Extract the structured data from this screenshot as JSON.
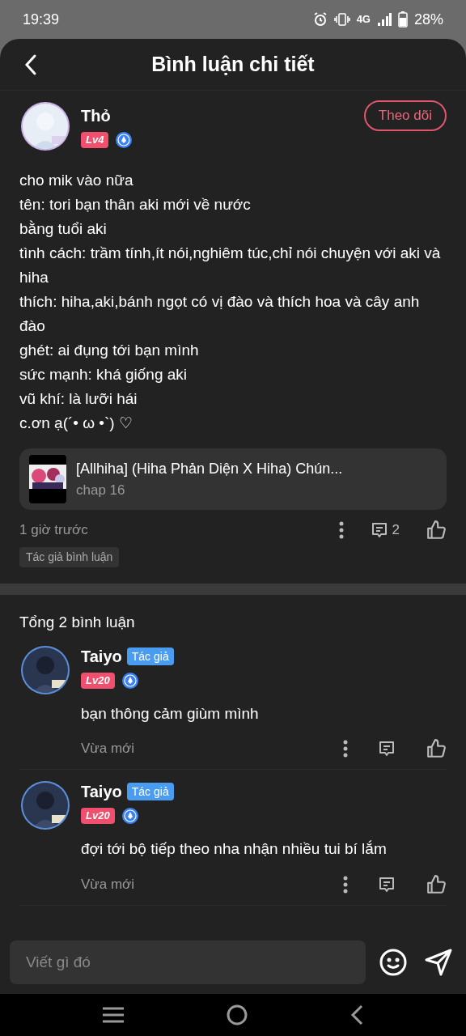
{
  "status_bar": {
    "time": "19:39",
    "network_label": "4G",
    "battery": "28%"
  },
  "header": {
    "title": "Bình luận chi tiết"
  },
  "post": {
    "author": "Thỏ",
    "level": "Lv4",
    "follow_button": "Theo dõi",
    "lines": [
      "cho mik vào nữa",
      "tên: tori bạn thân aki mới về nước",
      "bằng tuổi aki",
      "tình cách: trầm tính,ít nói,nghiêm túc,chỉ nói chuyện với aki và hiha",
      "thích: hiha,aki,bánh ngọt có vị đào và thích hoa và cây anh đào",
      "ghét: ai đụng tới bạn mình",
      "sức mạnh: khá giống aki",
      "vũ khí: là lưỡi hái",
      "c.ơn ạ(´• ω •`) ♡"
    ],
    "story": {
      "title": "[Allhiha] (Hiha Phản Diện X Hiha) Chún...",
      "chapter": "chap 16"
    },
    "time": "1 giờ trước",
    "reply_count": "2",
    "tag": "Tác giả bình luận"
  },
  "replies": {
    "total": "Tổng 2 bình luận",
    "items": [
      {
        "author": "Taiyo",
        "badge": "Tác giả",
        "level": "Lv20",
        "text": "bạn thông cảm giùm mình",
        "time": "Vừa mới"
      },
      {
        "author": "Taiyo",
        "badge": "Tác giả",
        "level": "Lv20",
        "text": "đợi tới bộ tiếp theo nha nhận nhiều tui bí lắm",
        "time": "Vừa mới"
      }
    ]
  },
  "composer": {
    "placeholder": "Viết gì đó"
  }
}
